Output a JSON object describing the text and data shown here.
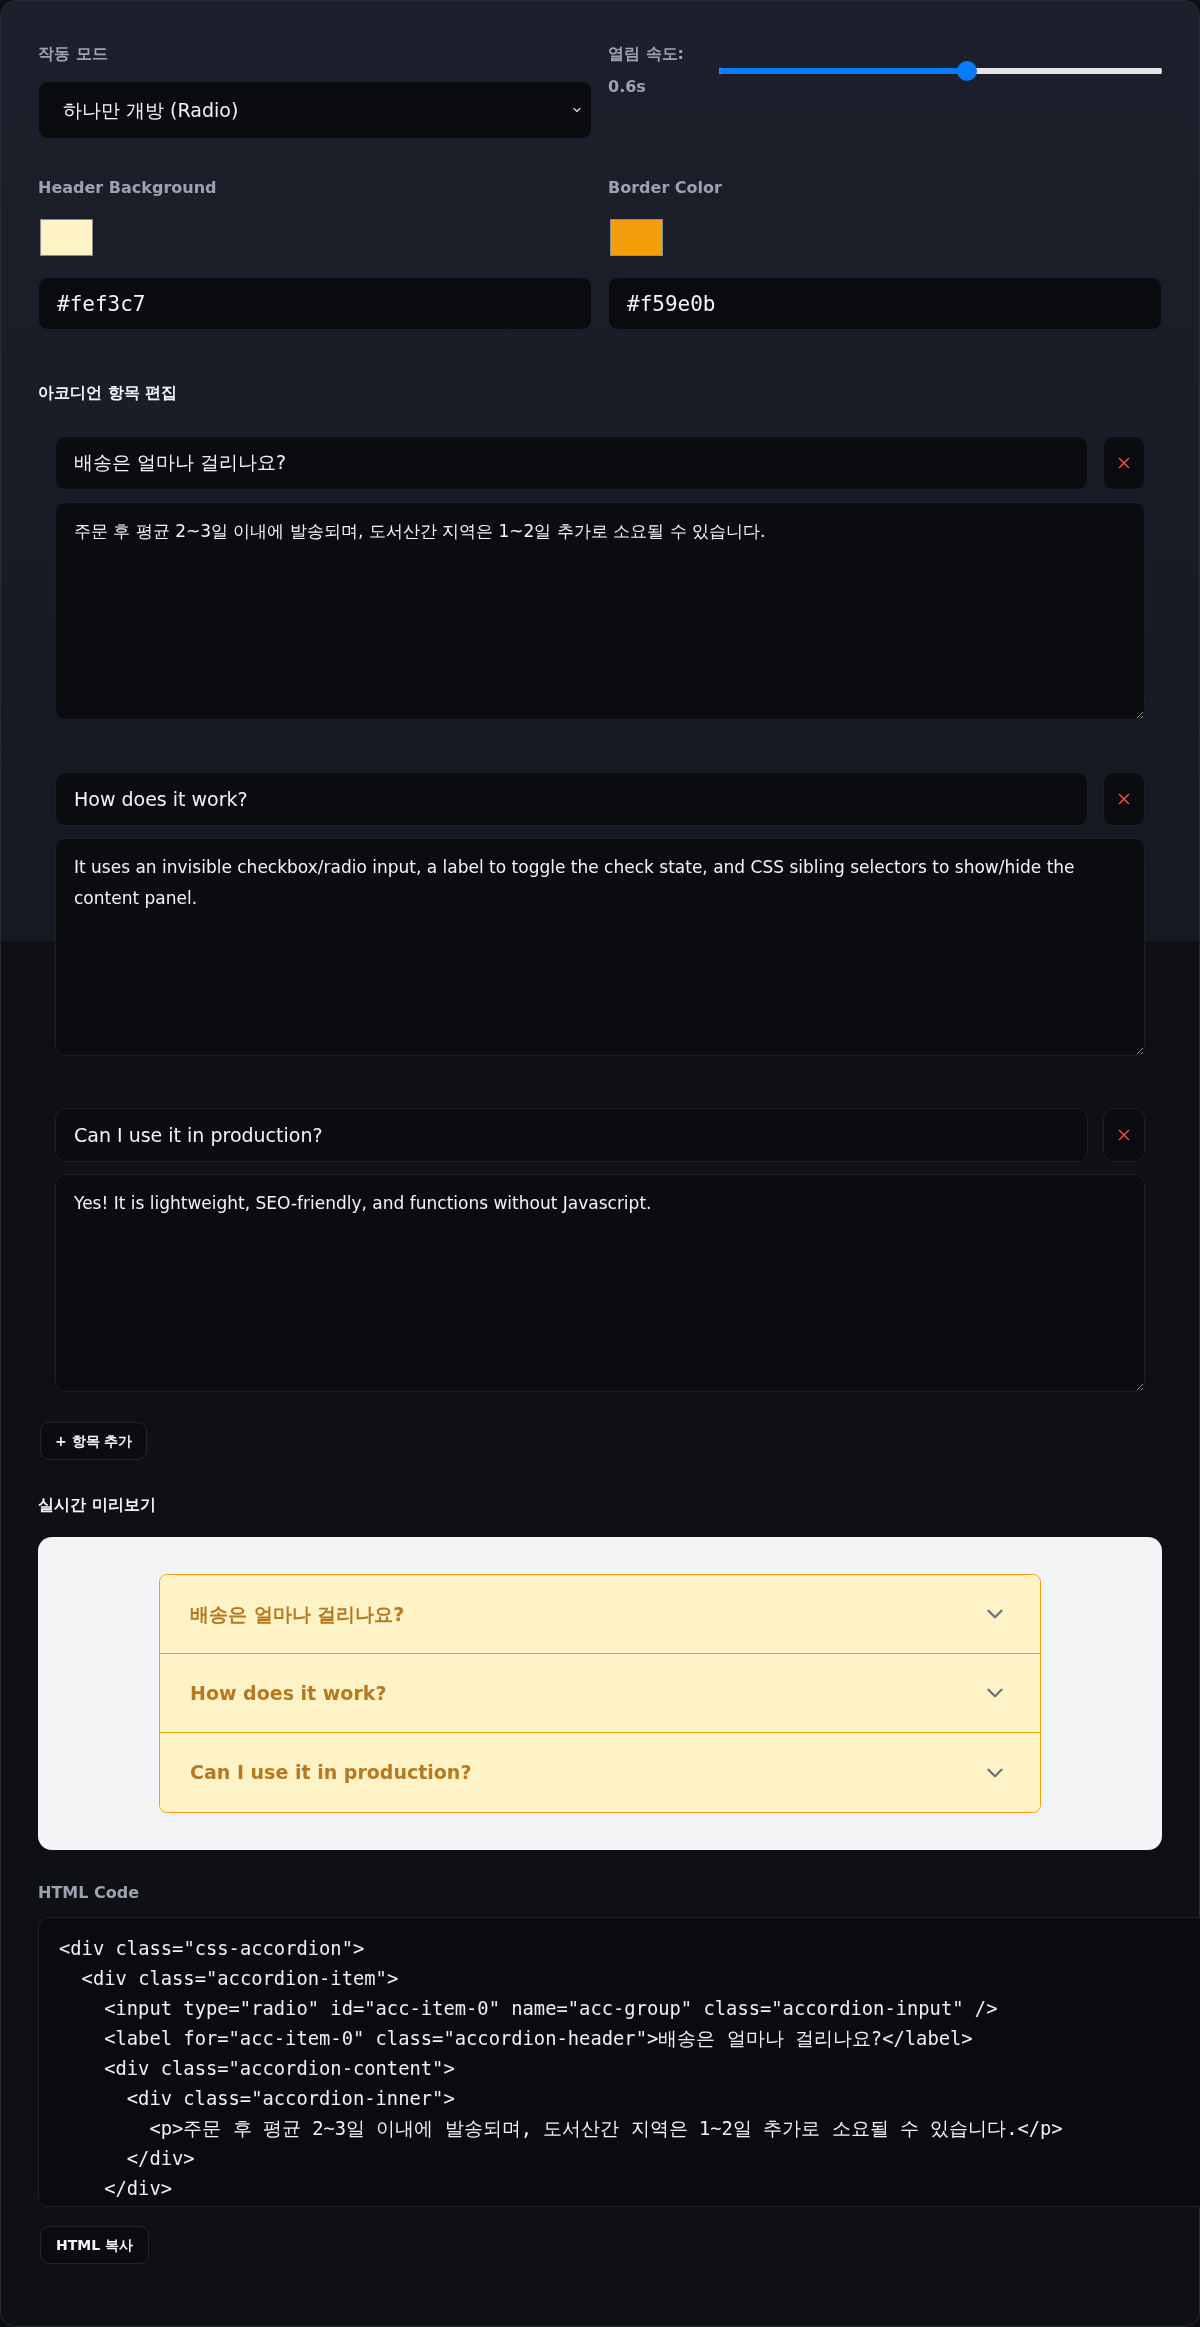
{
  "settings": {
    "mode": {
      "label": "작동 모드",
      "value": "하나만 개방 (Radio)"
    },
    "speed": {
      "label": "열림 속도:",
      "reading": "0.6s",
      "level": 0.56
    },
    "colors": [
      {
        "kind": "background",
        "label": "Header Background",
        "color": "#fef3c7",
        "value": "#fef3c7"
      },
      {
        "kind": "border",
        "label": "Border Color",
        "color": "#f59e0b",
        "value": "#f59e0b"
      }
    ]
  },
  "editor": {
    "title": "아코디언 항목 편집",
    "items": [
      {
        "question": "배송은 얼마나 걸리나요?",
        "answer": "주문 후 평균 2~3일 이내에 발송되며, 도서산간 지역은 1~2일 추가로 소요될 수 있습니다."
      },
      {
        "question": "How does it work?",
        "answer": "It uses an invisible checkbox/radio input, a label to toggle the check state, and CSS sibling selectors to show/hide the content panel."
      },
      {
        "question": "Can I use it in production?",
        "answer": "Yes! It is lightweight, SEO-friendly, and functions without Javascript."
      }
    ],
    "add_button": "+ 항목 추가"
  },
  "preview": {
    "title": "실시간 미리보기",
    "items": [
      {
        "header": "배송은 얼마나 걸리나요?",
        "expanded": false
      },
      {
        "header": "How does it work?",
        "expanded": false
      },
      {
        "header": "Can I use it in production?",
        "expanded": false
      }
    ]
  },
  "code": {
    "label": "HTML Code",
    "lines": [
      {
        "text": "<div class=\"css-accordion\">",
        "children": [
          {
            "text": "<div class=\"accordion-item\">",
            "children": [
              {
                "text": "<input type=\"radio\" id=\"acc-item-0\" name=\"acc-group\" class=\"accordion-input\" />"
              },
              {
                "text": "<label for=\"acc-item-0\" class=\"accordion-header\">배송은 얼마나 걸리나요?</label>"
              },
              {
                "text": "<div class=\"accordion-content\">",
                "children": [
                  {
                    "text": "<div class=\"accordion-inner\">",
                    "children": [
                      {
                        "text": "<p>주문 후 평균 2~3일 이내에 발송되며, 도서산간 지역은 1~2일 추가로 소요될 수 있습니다.</p>"
                      }
                    ],
                    "close": "</div>"
                  }
                ],
                "close": "</div>"
              }
            ]
          }
        ]
      }
    ],
    "copy_button": "HTML 복사"
  }
}
